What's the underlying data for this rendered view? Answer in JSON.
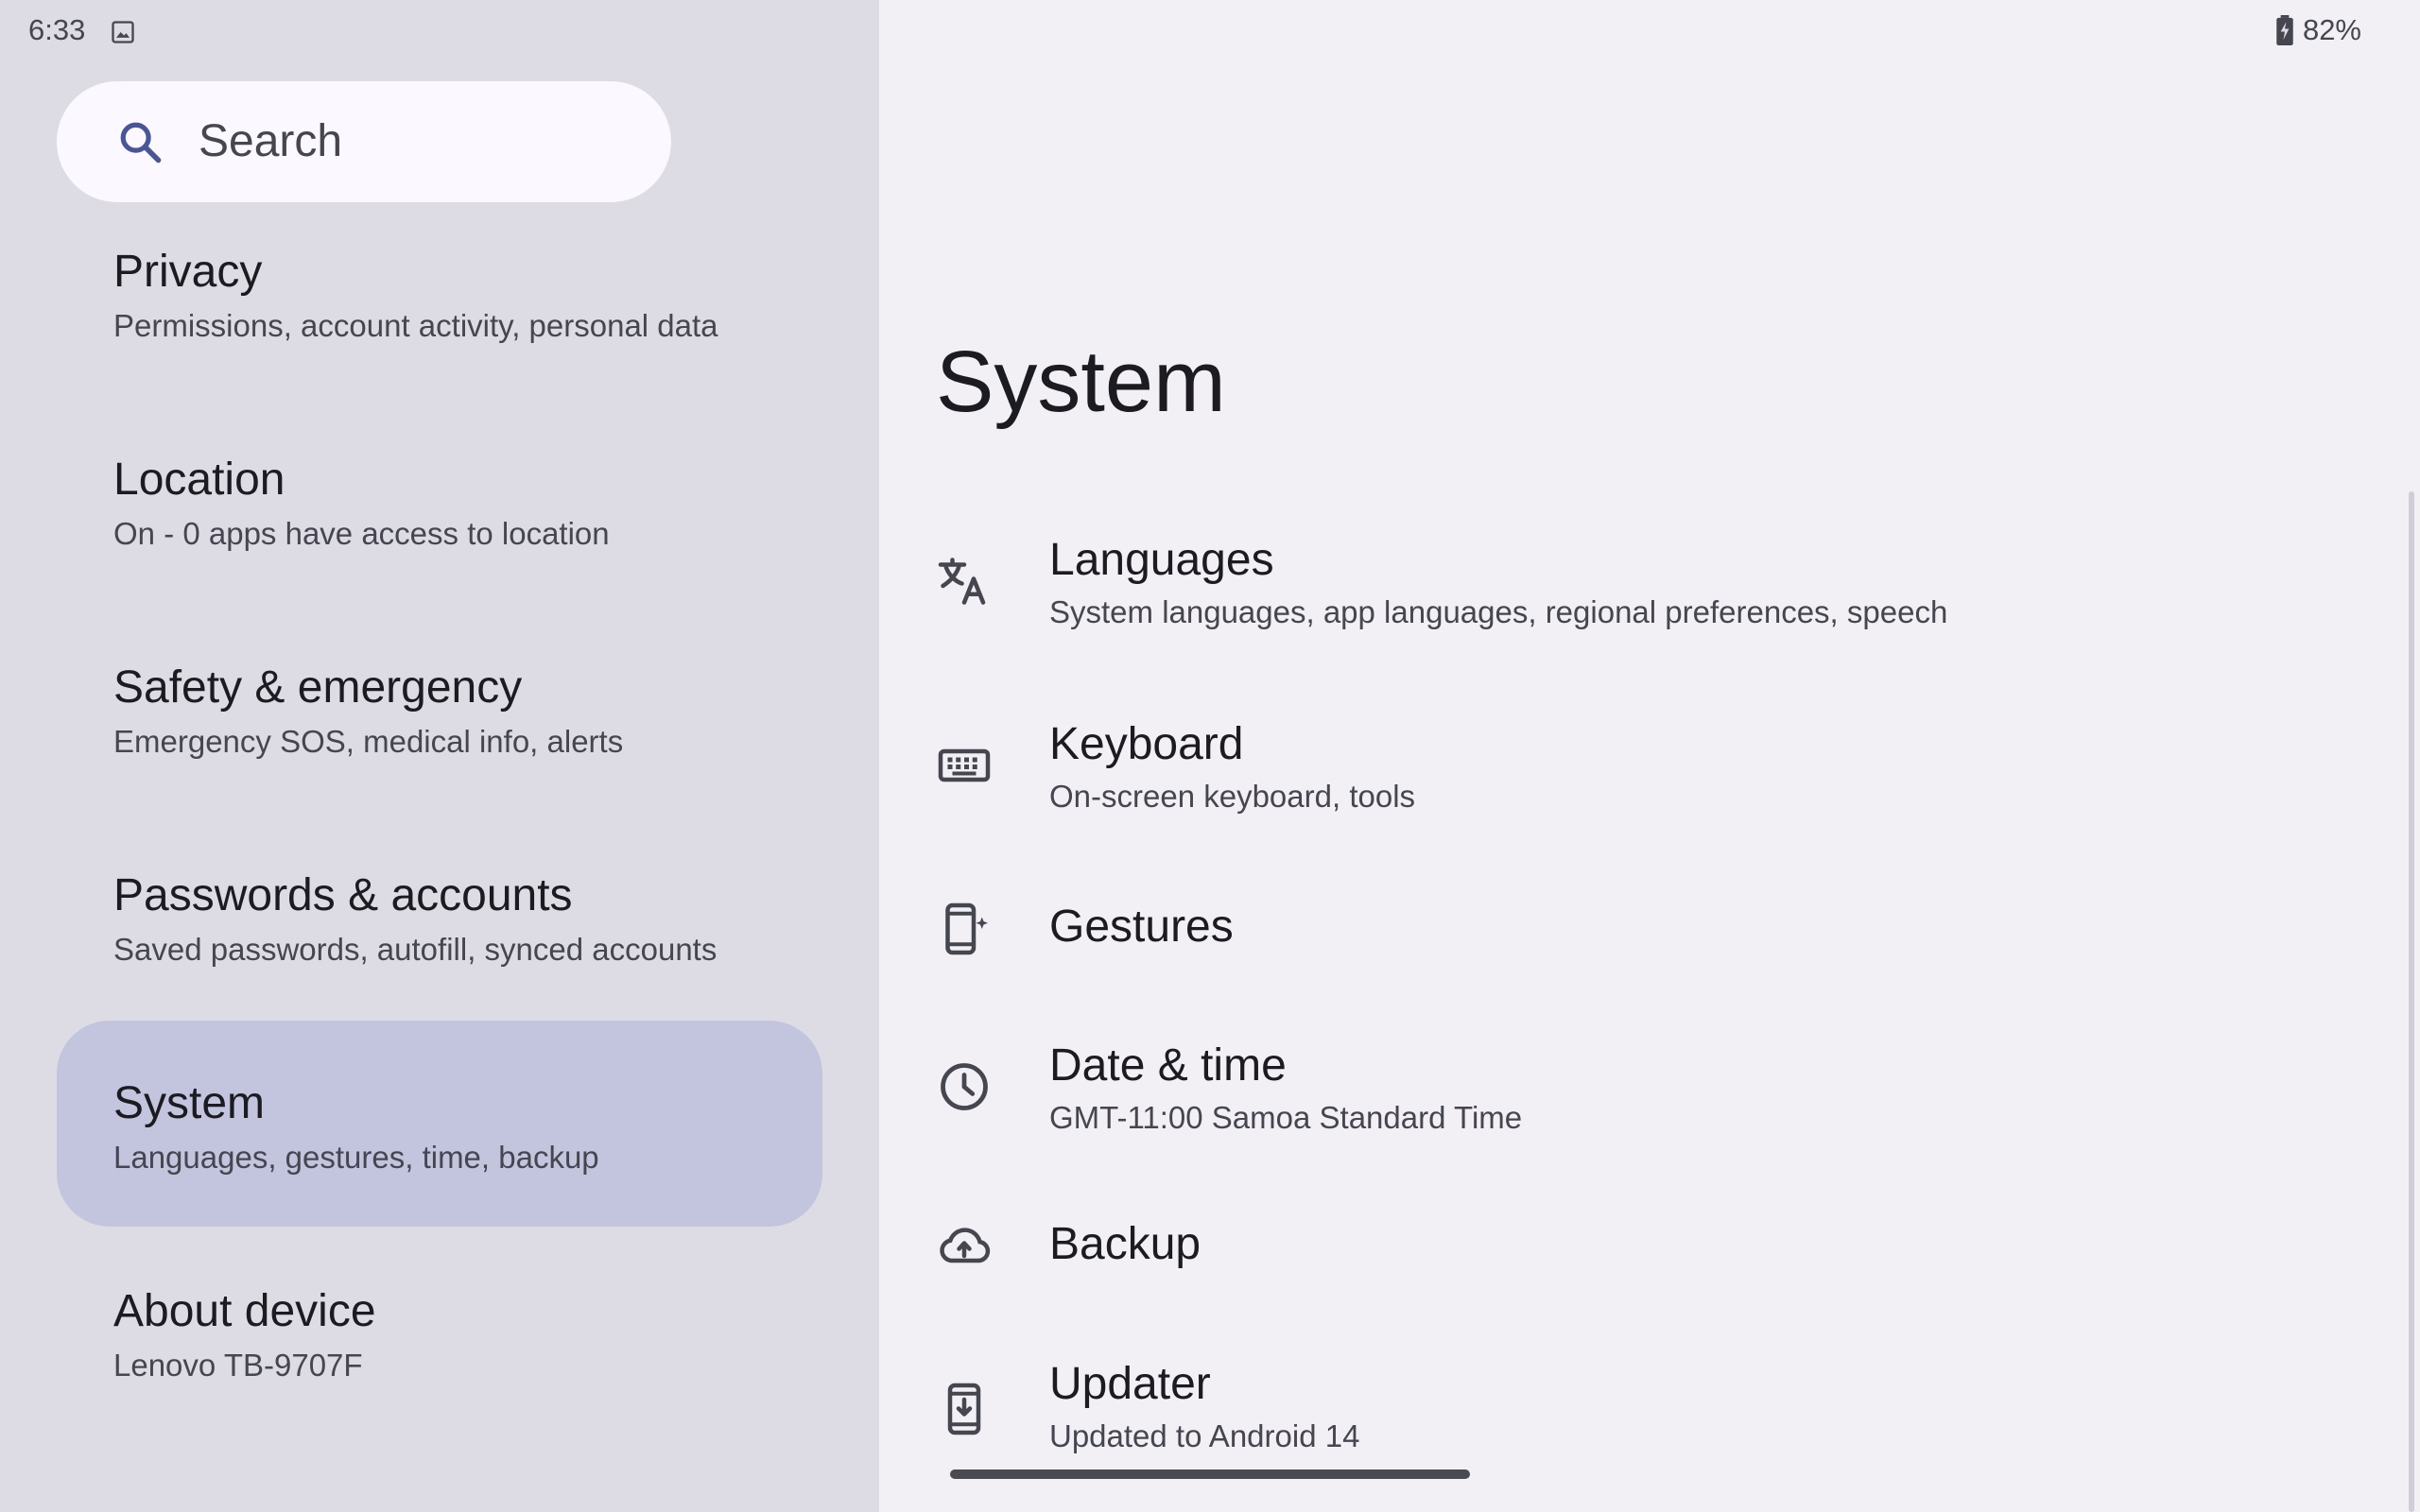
{
  "status_bar": {
    "time": "6:33",
    "battery": "82%"
  },
  "search": {
    "placeholder": "Search"
  },
  "sidebar": {
    "items": [
      {
        "title": "Privacy",
        "subtitle": "Permissions, account activity, personal data"
      },
      {
        "title": "Location",
        "subtitle": "On - 0 apps have access to location"
      },
      {
        "title": "Safety & emergency",
        "subtitle": "Emergency SOS, medical info, alerts"
      },
      {
        "title": "Passwords & accounts",
        "subtitle": "Saved passwords, autofill, synced accounts"
      },
      {
        "title": "System",
        "subtitle": "Languages, gestures, time, backup",
        "selected": true
      },
      {
        "title": "About device",
        "subtitle": "Lenovo TB-9707F"
      }
    ]
  },
  "main": {
    "title": "System",
    "items": [
      {
        "icon": "translate-icon",
        "title": "Languages",
        "subtitle": "System languages, app languages, regional preferences, speech"
      },
      {
        "icon": "keyboard-icon",
        "title": "Keyboard",
        "subtitle": "On-screen keyboard, tools"
      },
      {
        "icon": "gestures-icon",
        "title": "Gestures"
      },
      {
        "icon": "clock-icon",
        "title": "Date & time",
        "subtitle": "GMT-11:00 Samoa Standard Time"
      },
      {
        "icon": "cloud-upload-icon",
        "title": "Backup"
      },
      {
        "icon": "system-update-icon",
        "title": "Updater",
        "subtitle": "Updated to Android 14"
      }
    ]
  },
  "colors": {
    "left_bg": "#dddce4",
    "right_bg": "#f2f0f5",
    "selected_bg": "#c3c4de",
    "search_icon": "#4a5596"
  }
}
